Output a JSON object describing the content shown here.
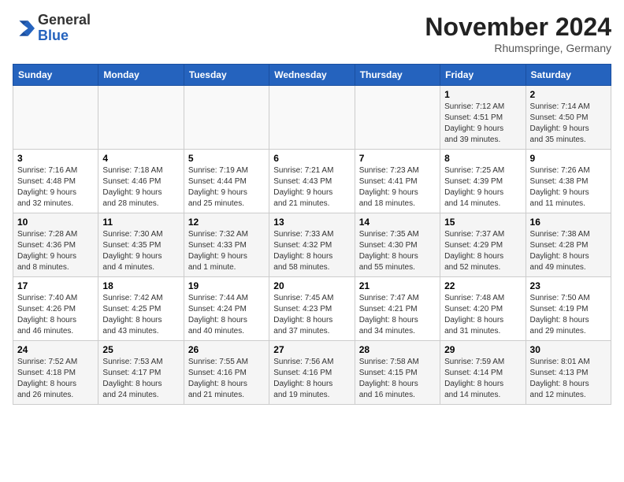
{
  "logo": {
    "text_general": "General",
    "text_blue": "Blue"
  },
  "header": {
    "month": "November 2024",
    "location": "Rhumspringe, Germany"
  },
  "weekdays": [
    "Sunday",
    "Monday",
    "Tuesday",
    "Wednesday",
    "Thursday",
    "Friday",
    "Saturday"
  ],
  "weeks": [
    [
      {
        "day": "",
        "info": ""
      },
      {
        "day": "",
        "info": ""
      },
      {
        "day": "",
        "info": ""
      },
      {
        "day": "",
        "info": ""
      },
      {
        "day": "",
        "info": ""
      },
      {
        "day": "1",
        "info": "Sunrise: 7:12 AM\nSunset: 4:51 PM\nDaylight: 9 hours\nand 39 minutes."
      },
      {
        "day": "2",
        "info": "Sunrise: 7:14 AM\nSunset: 4:50 PM\nDaylight: 9 hours\nand 35 minutes."
      }
    ],
    [
      {
        "day": "3",
        "info": "Sunrise: 7:16 AM\nSunset: 4:48 PM\nDaylight: 9 hours\nand 32 minutes."
      },
      {
        "day": "4",
        "info": "Sunrise: 7:18 AM\nSunset: 4:46 PM\nDaylight: 9 hours\nand 28 minutes."
      },
      {
        "day": "5",
        "info": "Sunrise: 7:19 AM\nSunset: 4:44 PM\nDaylight: 9 hours\nand 25 minutes."
      },
      {
        "day": "6",
        "info": "Sunrise: 7:21 AM\nSunset: 4:43 PM\nDaylight: 9 hours\nand 21 minutes."
      },
      {
        "day": "7",
        "info": "Sunrise: 7:23 AM\nSunset: 4:41 PM\nDaylight: 9 hours\nand 18 minutes."
      },
      {
        "day": "8",
        "info": "Sunrise: 7:25 AM\nSunset: 4:39 PM\nDaylight: 9 hours\nand 14 minutes."
      },
      {
        "day": "9",
        "info": "Sunrise: 7:26 AM\nSunset: 4:38 PM\nDaylight: 9 hours\nand 11 minutes."
      }
    ],
    [
      {
        "day": "10",
        "info": "Sunrise: 7:28 AM\nSunset: 4:36 PM\nDaylight: 9 hours\nand 8 minutes."
      },
      {
        "day": "11",
        "info": "Sunrise: 7:30 AM\nSunset: 4:35 PM\nDaylight: 9 hours\nand 4 minutes."
      },
      {
        "day": "12",
        "info": "Sunrise: 7:32 AM\nSunset: 4:33 PM\nDaylight: 9 hours\nand 1 minute."
      },
      {
        "day": "13",
        "info": "Sunrise: 7:33 AM\nSunset: 4:32 PM\nDaylight: 8 hours\nand 58 minutes."
      },
      {
        "day": "14",
        "info": "Sunrise: 7:35 AM\nSunset: 4:30 PM\nDaylight: 8 hours\nand 55 minutes."
      },
      {
        "day": "15",
        "info": "Sunrise: 7:37 AM\nSunset: 4:29 PM\nDaylight: 8 hours\nand 52 minutes."
      },
      {
        "day": "16",
        "info": "Sunrise: 7:38 AM\nSunset: 4:28 PM\nDaylight: 8 hours\nand 49 minutes."
      }
    ],
    [
      {
        "day": "17",
        "info": "Sunrise: 7:40 AM\nSunset: 4:26 PM\nDaylight: 8 hours\nand 46 minutes."
      },
      {
        "day": "18",
        "info": "Sunrise: 7:42 AM\nSunset: 4:25 PM\nDaylight: 8 hours\nand 43 minutes."
      },
      {
        "day": "19",
        "info": "Sunrise: 7:44 AM\nSunset: 4:24 PM\nDaylight: 8 hours\nand 40 minutes."
      },
      {
        "day": "20",
        "info": "Sunrise: 7:45 AM\nSunset: 4:23 PM\nDaylight: 8 hours\nand 37 minutes."
      },
      {
        "day": "21",
        "info": "Sunrise: 7:47 AM\nSunset: 4:21 PM\nDaylight: 8 hours\nand 34 minutes."
      },
      {
        "day": "22",
        "info": "Sunrise: 7:48 AM\nSunset: 4:20 PM\nDaylight: 8 hours\nand 31 minutes."
      },
      {
        "day": "23",
        "info": "Sunrise: 7:50 AM\nSunset: 4:19 PM\nDaylight: 8 hours\nand 29 minutes."
      }
    ],
    [
      {
        "day": "24",
        "info": "Sunrise: 7:52 AM\nSunset: 4:18 PM\nDaylight: 8 hours\nand 26 minutes."
      },
      {
        "day": "25",
        "info": "Sunrise: 7:53 AM\nSunset: 4:17 PM\nDaylight: 8 hours\nand 24 minutes."
      },
      {
        "day": "26",
        "info": "Sunrise: 7:55 AM\nSunset: 4:16 PM\nDaylight: 8 hours\nand 21 minutes."
      },
      {
        "day": "27",
        "info": "Sunrise: 7:56 AM\nSunset: 4:16 PM\nDaylight: 8 hours\nand 19 minutes."
      },
      {
        "day": "28",
        "info": "Sunrise: 7:58 AM\nSunset: 4:15 PM\nDaylight: 8 hours\nand 16 minutes."
      },
      {
        "day": "29",
        "info": "Sunrise: 7:59 AM\nSunset: 4:14 PM\nDaylight: 8 hours\nand 14 minutes."
      },
      {
        "day": "30",
        "info": "Sunrise: 8:01 AM\nSunset: 4:13 PM\nDaylight: 8 hours\nand 12 minutes."
      }
    ]
  ]
}
